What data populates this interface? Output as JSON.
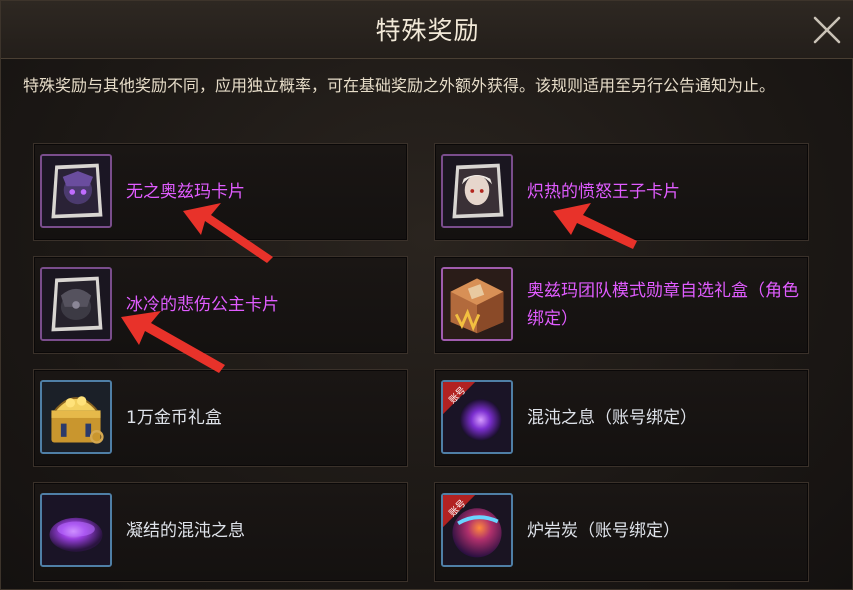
{
  "dialog": {
    "title": "特殊奖励",
    "close_icon": "close-icon",
    "description": "特殊奖励与其他奖励不同，应用独立概率，可在基础奖励之外额外获得。该规则适用至另行公告通知为止。"
  },
  "rewards": [
    {
      "label": "无之奥兹玛卡片",
      "icon": "dark-card-icon",
      "rarity_color": "#e05cff"
    },
    {
      "label": "炽热的愤怒王子卡片",
      "icon": "white-hair-card-icon",
      "rarity_color": "#e05cff"
    },
    {
      "label": "冰冷的悲伤公主卡片",
      "icon": "dark-princess-card-icon",
      "rarity_color": "#e05cff"
    },
    {
      "label": "奥兹玛团队模式勋章自选礼盒（角色绑定）",
      "icon": "medal-box-icon",
      "rarity_color": "#e05cff"
    },
    {
      "label": "1万金币礼盒",
      "icon": "gold-chest-icon",
      "rarity_color": "#dfe3ea"
    },
    {
      "label": "混沌之息（账号绑定）",
      "icon": "chaos-orb-icon",
      "badge": "账号",
      "rarity_color": "#dfe3ea"
    },
    {
      "label": "凝结的混沌之息",
      "icon": "purple-crystal-icon",
      "rarity_color": "#dfe3ea"
    },
    {
      "label": "炉岩炭（账号绑定）",
      "icon": "lava-coal-icon",
      "badge": "账号",
      "rarity_color": "#dfe3ea"
    }
  ],
  "colors": {
    "accent_purple": "#e05cff",
    "arrow_red": "#e8322a",
    "frame_purple": "#7a4d8c",
    "frame_blue": "#4f7fa6"
  }
}
